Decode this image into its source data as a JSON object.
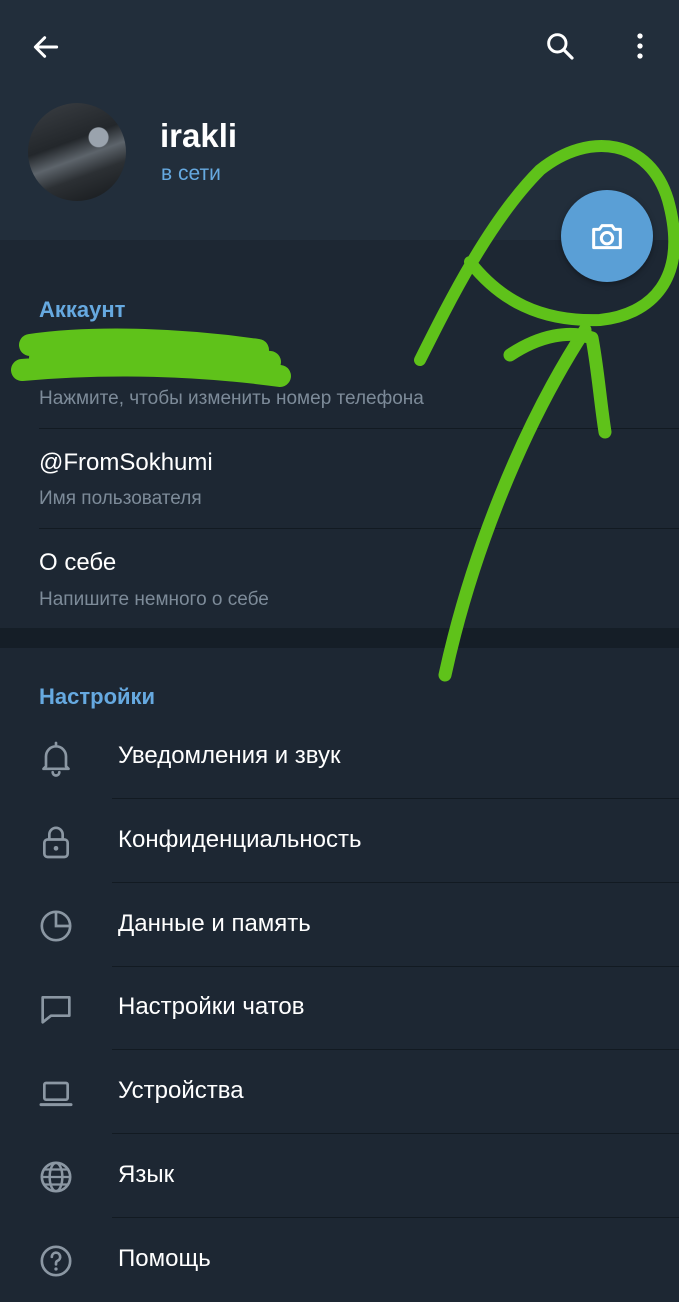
{
  "profile": {
    "name": "irakli",
    "status": "в сети"
  },
  "account": {
    "section_title": "Аккаунт",
    "phone_hint": "Нажмите, чтобы изменить номер телефона",
    "username": "@FromSokhumi",
    "username_label": "Имя пользователя",
    "bio_title": "О себе",
    "bio_hint": "Напишите немного о себе"
  },
  "settings": {
    "section_title": "Настройки",
    "items": [
      {
        "label": "Уведомления и звук",
        "icon": "bell-icon"
      },
      {
        "label": "Конфиденциальность",
        "icon": "lock-icon"
      },
      {
        "label": "Данные и память",
        "icon": "pie-chart-icon"
      },
      {
        "label": "Настройки чатов",
        "icon": "chat-bubble-icon"
      },
      {
        "label": "Устройства",
        "icon": "laptop-icon"
      },
      {
        "label": "Язык",
        "icon": "globe-icon"
      },
      {
        "label": "Помощь",
        "icon": "help-icon"
      }
    ]
  },
  "colors": {
    "background": "#1d2733",
    "header": "#222e3b",
    "accent": "#66a9e0",
    "camera_button": "#5a9fd6",
    "annotation": "#5fc21a"
  }
}
